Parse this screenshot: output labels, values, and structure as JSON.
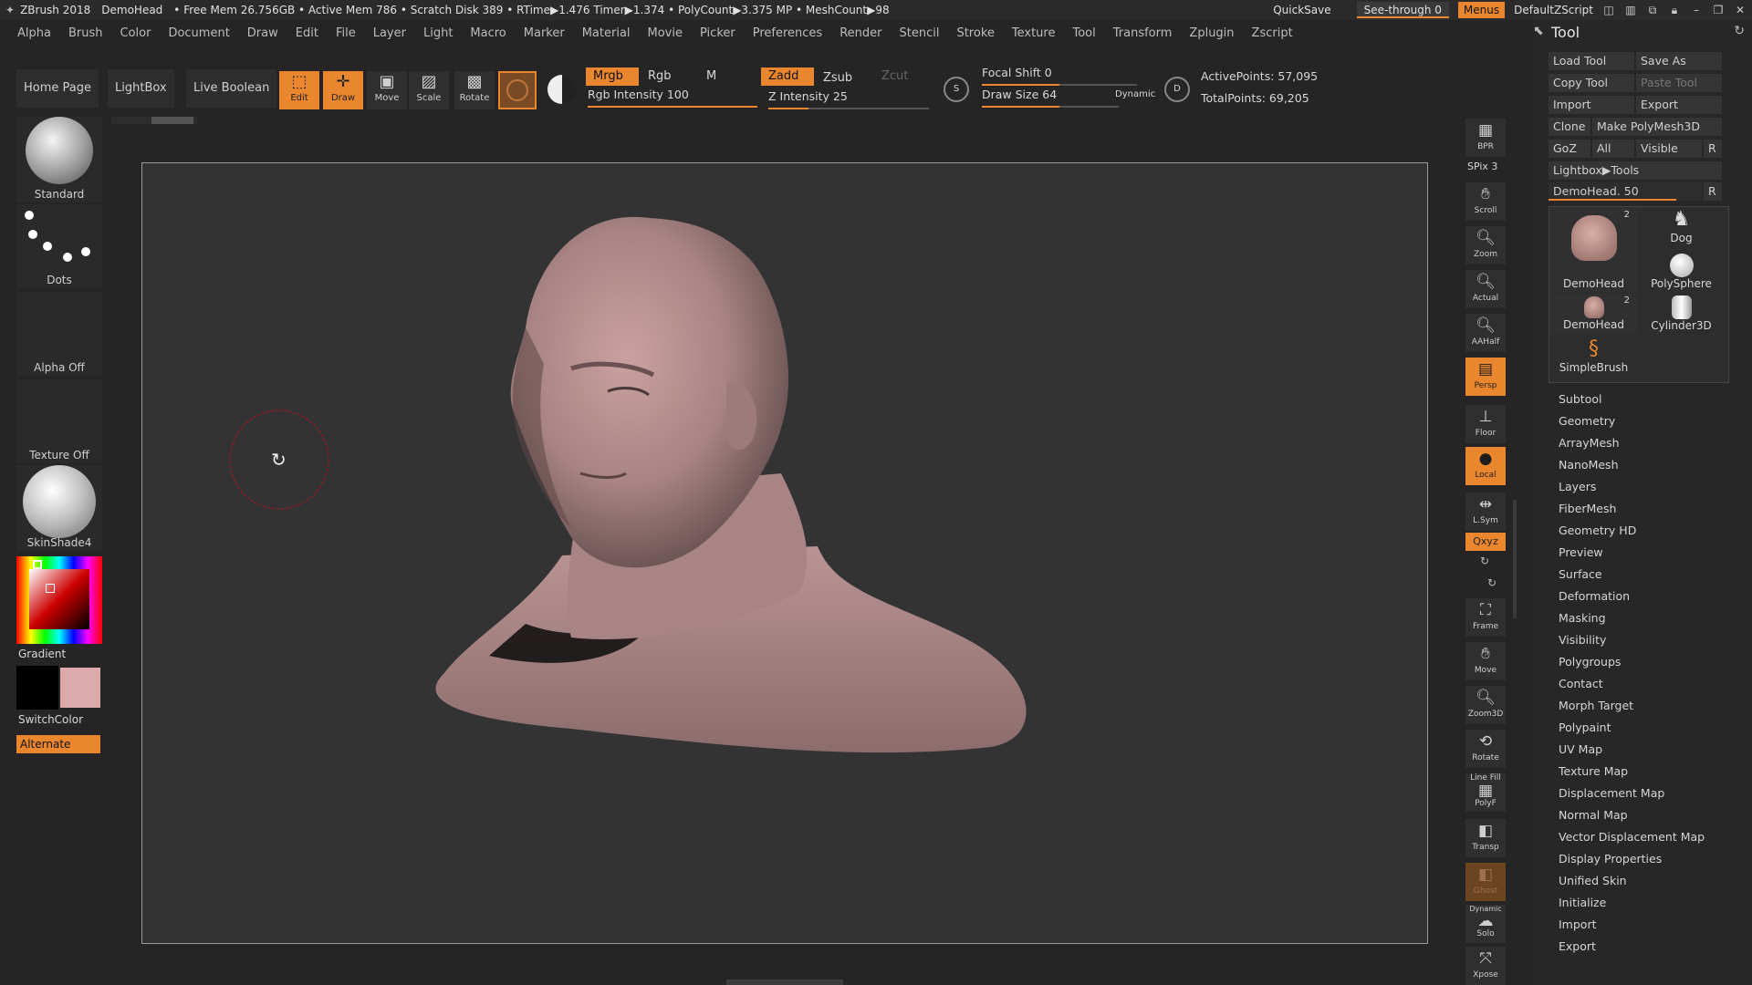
{
  "titlebar": {
    "app": "ZBrush 2018",
    "document": "DemoHead",
    "stats": "• Free Mem 26.756GB • Active Mem 786 • Scratch Disk 389 • RTime▶1.476 Timer▶1.374 • PolyCount▶3.375 MP • MeshCount▶98",
    "quicksave": "QuickSave",
    "seethrough": "See-through  0",
    "menus": "Menus",
    "script": "DefaultZScript"
  },
  "menubar": [
    "Alpha",
    "Brush",
    "Color",
    "Document",
    "Draw",
    "Edit",
    "File",
    "Layer",
    "Light",
    "Macro",
    "Marker",
    "Material",
    "Movie",
    "Picker",
    "Preferences",
    "Render",
    "Stencil",
    "Stroke",
    "Texture",
    "Tool",
    "Transform",
    "Zplugin",
    "Zscript"
  ],
  "shelf": {
    "home": "Home Page",
    "lightbox": "LightBox",
    "liveboolean": "Live Boolean",
    "tools": {
      "edit": "Edit",
      "draw": "Draw",
      "move": "Move",
      "scale": "Scale",
      "rotate": "Rotate"
    },
    "mrgb": "Mrgb",
    "rgb": "Rgb",
    "m": "M",
    "zadd": "Zadd",
    "zsub": "Zsub",
    "zcut": "Zcut",
    "rgb_intensity": "Rgb Intensity 100",
    "z_intensity": "Z Intensity 25",
    "focal_shift": "Focal Shift 0",
    "draw_size": "Draw Size 64",
    "dynamic": "Dynamic",
    "active_points": "ActivePoints: 57,095",
    "total_points": "TotalPoints: 69,205",
    "rgb_intensity_value": 100,
    "z_intensity_value": 25,
    "focal_shift_value": 0,
    "draw_size_value": 64
  },
  "left": {
    "brush": "Standard",
    "stroke": "Dots",
    "alpha": "Alpha Off",
    "texture": "Texture Off",
    "material": "SkinShade4",
    "gradient": "Gradient",
    "switchcolor": "SwitchColor",
    "alternate": "Alternate",
    "main_color": "#000000",
    "secondary_color": "#dcaaaa"
  },
  "dock": {
    "bpr": "BPR",
    "spix": "SPix 3",
    "scroll": "Scroll",
    "zoom": "Zoom",
    "actual": "Actual",
    "aahalf": "AAHalf",
    "persp": "Persp",
    "dynamic": "Dynamic",
    "floor": "Floor",
    "local": "Local",
    "lsym": "L.Sym",
    "xyz": "Qxyz",
    "frame": "Frame",
    "move": "Move",
    "zoom3d": "Zoom3D",
    "rotate": "Rotate",
    "linefill": "Line Fill",
    "polyf": "PolyF",
    "transp": "Transp",
    "ghost": "Ghost",
    "solo": "Solo",
    "xpose": "Xpose"
  },
  "tool": {
    "title": "Tool",
    "buttons": {
      "load": "Load Tool",
      "saveas": "Save As",
      "copy": "Copy Tool",
      "paste": "Paste Tool",
      "import": "Import",
      "export": "Export",
      "clone": "Clone",
      "makepoly": "Make PolyMesh3D",
      "goz": "GoZ",
      "all": "All",
      "visible": "Visible",
      "r": "R"
    },
    "lightbox_tools": "Lightbox▶Tools",
    "current": "DemoHead. 50",
    "current_value": 50,
    "thumbs": [
      {
        "label": "DemoHead",
        "badge": "2"
      },
      {
        "label": "Dog"
      },
      {
        "label": "PolySphere"
      },
      {
        "label": "DemoHead",
        "badge": "2"
      },
      {
        "label": "Cylinder3D"
      },
      {
        "label": "SimpleBrush"
      }
    ],
    "subpalettes": [
      "Subtool",
      "Geometry",
      "ArrayMesh",
      "NanoMesh",
      "Layers",
      "FiberMesh",
      "Geometry HD",
      "Preview",
      "Surface",
      "Deformation",
      "Masking",
      "Visibility",
      "Polygroups",
      "Contact",
      "Morph Target",
      "Polypaint",
      "UV Map",
      "Texture Map",
      "Displacement Map",
      "Normal Map",
      "Vector Displacement Map",
      "Display Properties",
      "Unified Skin",
      "Initialize",
      "Import",
      "Export"
    ]
  },
  "colors": {
    "accent": "#e9862e",
    "skin": "#b58e8e",
    "canvas": "#333333"
  }
}
